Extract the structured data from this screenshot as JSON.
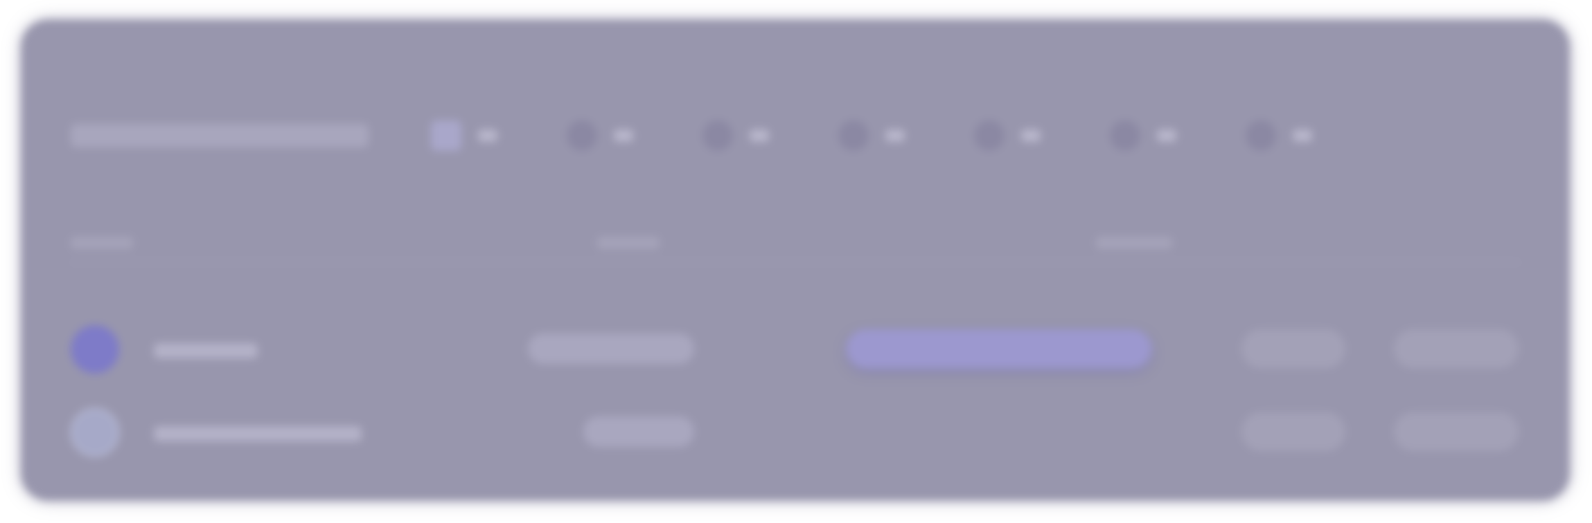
{
  "colors": {
    "background": "#ffffff",
    "card": "#9896ad",
    "accent": "#9c98cf",
    "avatar": "#7e7bc8"
  },
  "header": {
    "title": "",
    "filters": [
      {
        "icon": "grid-icon",
        "count": ""
      },
      {
        "icon": "person-icon",
        "count": ""
      },
      {
        "icon": "person-icon",
        "count": ""
      },
      {
        "icon": "person-icon",
        "count": ""
      },
      {
        "icon": "person-icon",
        "count": ""
      },
      {
        "icon": "person-icon",
        "count": ""
      },
      {
        "icon": "person-icon",
        "count": ""
      }
    ]
  },
  "table": {
    "rows": [
      {
        "name": "",
        "status": "",
        "highlight": "",
        "actions": [
          "",
          ""
        ]
      },
      {
        "name": "",
        "status": "",
        "highlight": "",
        "actions": [
          "",
          ""
        ]
      }
    ]
  }
}
